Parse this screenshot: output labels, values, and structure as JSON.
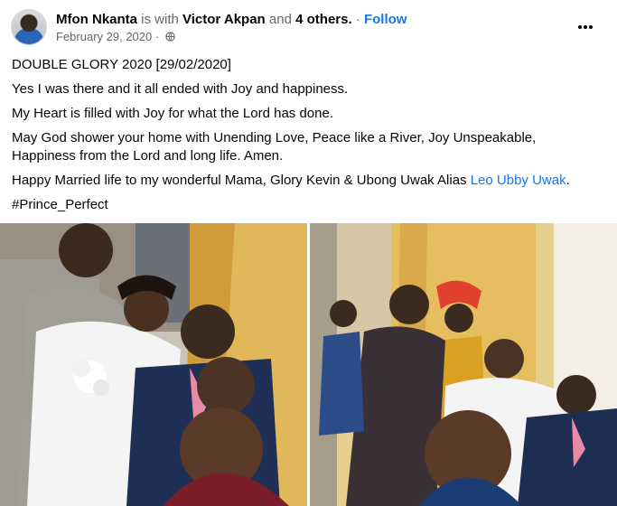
{
  "post": {
    "author": "Mfon Nkanta",
    "is_with": "is with",
    "tagged": "Victor Akpan",
    "and": "and",
    "others": "4 others.",
    "separator": "·",
    "follow": "Follow",
    "date": "February 29, 2020",
    "date_separator": "·",
    "more_icon": "more-horizontal-icon",
    "audience_icon": "globe-icon",
    "lines": {
      "title": "DOUBLE GLORY 2020 [29/02/2020]",
      "line1": "Yes I was there and it all ended with Joy and happiness.",
      "line2": "My Heart is filled with Joy for what the Lord has done.",
      "line3": "May God shower your home with Unending Love, Peace like a River, Joy Unspeakable, Happiness from the Lord and long life. Amen.",
      "line4_prefix": "Happy Married life to my wonderful Mama, Glory Kevin & Ubong Uwak Alias ",
      "line4_link": "Leo Ubby Uwak",
      "line4_suffix": ".",
      "hashtag": "#Prince_Perfect"
    }
  },
  "colors": {
    "text": "#050505",
    "muted": "#65676b",
    "link": "#1b74e4",
    "background": "#ffffff"
  }
}
